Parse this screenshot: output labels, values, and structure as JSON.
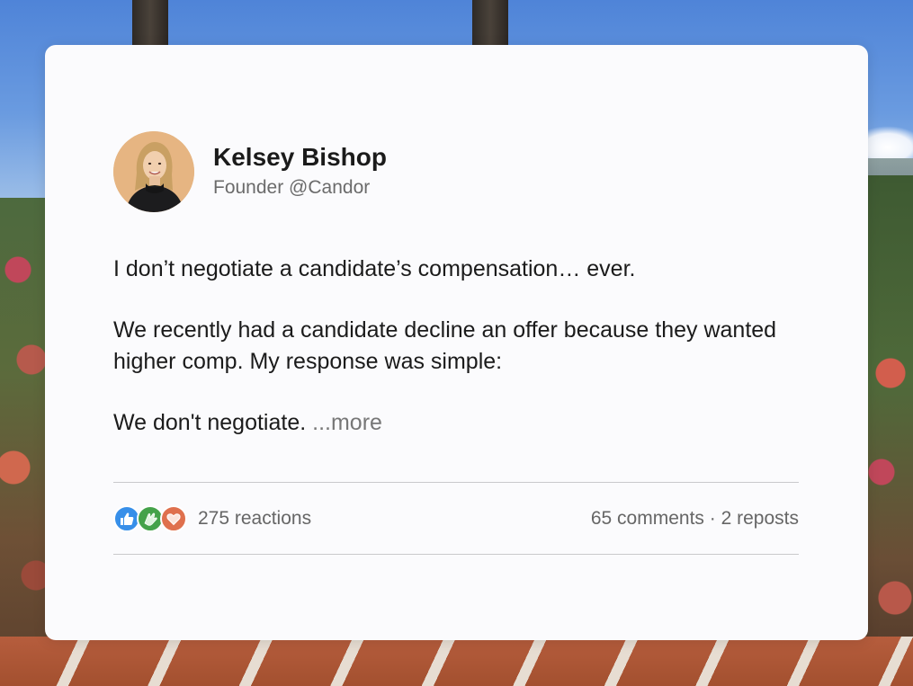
{
  "post": {
    "author": {
      "name": "Kelsey Bishop",
      "title": "Founder @Candor"
    },
    "paragraphs": [
      "I don’t negotiate a candidate’s compensation… ever.",
      "We recently had a candidate decline an offer because they wanted higher comp. My response was simple:"
    ],
    "last_line": "We don't negotiate.",
    "more_label": "...more",
    "reactions_label": "275 reactions",
    "comments_label": "65 comments",
    "separator": "·",
    "reposts_label": "2 reposts",
    "reaction_icons": [
      "like-icon",
      "celebrate-icon",
      "love-icon"
    ]
  },
  "colors": {
    "card_bg": "#fbfbfd",
    "like": "#378fe9",
    "celebrate": "#44a24a",
    "love": "#df704d",
    "muted_text": "#666666"
  }
}
